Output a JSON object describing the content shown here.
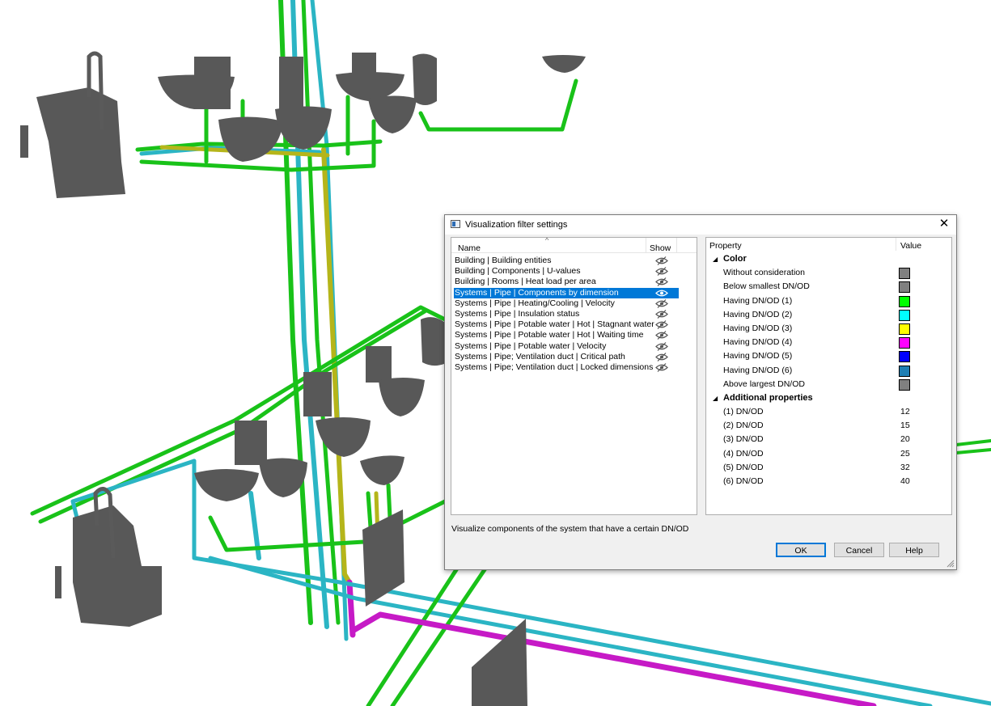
{
  "dialog": {
    "title": "Visualization filter settings",
    "close_glyph": "✕",
    "list": {
      "sort_glyph": "^",
      "columns": {
        "name": "Name",
        "show": "Show"
      },
      "items": [
        {
          "label": "Building | Building entities",
          "visible": false
        },
        {
          "label": "Building | Components | U-values",
          "visible": false
        },
        {
          "label": "Building | Rooms | Heat load per area",
          "visible": false
        },
        {
          "label": "Systems | Pipe | Components by dimension",
          "visible": true
        },
        {
          "label": "Systems | Pipe | Heating/Cooling | Velocity",
          "visible": false
        },
        {
          "label": "Systems | Pipe | Insulation status",
          "visible": false
        },
        {
          "label": "Systems | Pipe | Potable water | Hot | Stagnant water",
          "visible": false
        },
        {
          "label": "Systems | Pipe | Potable water | Hot | Waiting time",
          "visible": false
        },
        {
          "label": "Systems | Pipe | Potable water | Velocity",
          "visible": false
        },
        {
          "label": "Systems | Pipe; Ventilation duct | Critical path",
          "visible": false
        },
        {
          "label": "Systems | Pipe; Ventilation duct | Locked dimensions",
          "visible": false
        }
      ]
    },
    "description": "Visualize components of the system that have a certain DN/OD",
    "properties": {
      "columns": {
        "property": "Property",
        "value": "Value"
      },
      "categories": [
        {
          "label": "Color",
          "expand_glyph": "◢",
          "rows": [
            {
              "label": "Without consideration",
              "color": "#808080"
            },
            {
              "label": "Below smallest DN/OD",
              "color": "#808080"
            },
            {
              "label": "Having DN/OD (1)",
              "color": "#00ff00"
            },
            {
              "label": "Having DN/OD (2)",
              "color": "#00ffff"
            },
            {
              "label": "Having DN/OD (3)",
              "color": "#ffff00"
            },
            {
              "label": "Having DN/OD (4)",
              "color": "#ff00ff"
            },
            {
              "label": "Having DN/OD (5)",
              "color": "#0000ff"
            },
            {
              "label": "Having DN/OD (6)",
              "color": "#1e7fb4"
            },
            {
              "label": "Above largest DN/OD",
              "color": "#808080"
            }
          ]
        },
        {
          "label": "Additional properties",
          "expand_glyph": "◢",
          "rows": [
            {
              "label": "(1) DN/OD",
              "value": "12"
            },
            {
              "label": "(2) DN/OD",
              "value": "15"
            },
            {
              "label": "(3) DN/OD",
              "value": "20"
            },
            {
              "label": "(4) DN/OD",
              "value": "25"
            },
            {
              "label": "(5) DN/OD",
              "value": "32"
            },
            {
              "label": "(6) DN/OD",
              "value": "40"
            }
          ]
        }
      ]
    },
    "buttons": {
      "ok": "OK",
      "cancel": "Cancel",
      "help": "Help"
    }
  },
  "scene": {
    "pipe_colors": {
      "dn1": "#19c219",
      "dn2": "#2bb5c4",
      "dn3": "#b5b51a",
      "dn4": "#c61ac6",
      "fixture": "#585858"
    }
  }
}
